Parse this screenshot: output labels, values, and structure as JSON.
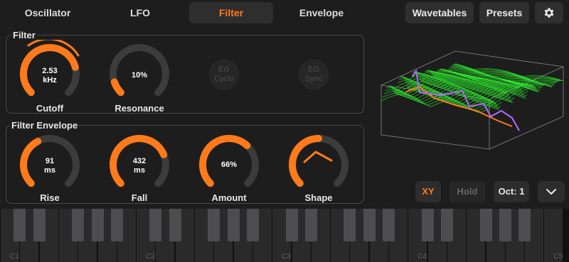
{
  "tabs": [
    {
      "label": "Oscillator",
      "active": false
    },
    {
      "label": "LFO",
      "active": false
    },
    {
      "label": "Filter",
      "active": true
    },
    {
      "label": "Envelope",
      "active": false
    }
  ],
  "toolbar": {
    "wavetables_label": "Wavetables",
    "presets_label": "Presets",
    "settings_icon": "gear-icon"
  },
  "filter_panel": {
    "title": "Filter",
    "cutoff": {
      "value_line1": "2.53",
      "value_line2": "kHz",
      "label": "Cutoff",
      "level": 0.78
    },
    "resonance": {
      "value": "10%",
      "label": "Resonance",
      "level": 0.1
    },
    "eg_cycle": {
      "line1": "EG",
      "line2": "Cycle"
    },
    "eg_sync": {
      "line1": "EG",
      "line2": "Sync"
    }
  },
  "envelope_panel": {
    "title": "Filter Envelope",
    "rise": {
      "value_line1": "91",
      "value_line2": "ms",
      "label": "Rise",
      "level": 0.4
    },
    "fall": {
      "value_line1": "432",
      "value_line2": "ms",
      "label": "Fall",
      "level": 0.75
    },
    "amount": {
      "value": "66%",
      "label": "Amount",
      "level": 0.66
    },
    "shape": {
      "label": "Shape",
      "level": 0.5
    }
  },
  "controls": {
    "xy_label": "XY",
    "hold_label": "Hold",
    "octave_label": "Oct: 1",
    "expand_icon": "chevron-down-icon"
  },
  "keyboard": {
    "octave_labels": [
      "C1",
      "C2",
      "C3",
      "C4",
      "C5"
    ]
  },
  "colors": {
    "accent": "#ff7a1a",
    "track": "#3c3c3c",
    "waveform": "#2ee82e",
    "highlight": "#b26bff"
  }
}
